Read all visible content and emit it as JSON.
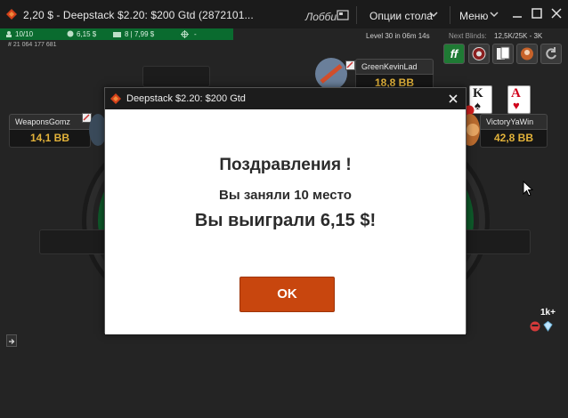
{
  "window": {
    "title": "2,20 $ - Deepstack $2.20: $200 Gtd  (2872101...",
    "lobby_label": "Лобби",
    "table_options_label": "Опции стола",
    "menu_label": "Меню"
  },
  "info": {
    "players": "10/10",
    "prize": "6,15 $",
    "tables": "8 | 7,99 $",
    "table_id": "# 21 064 177 681",
    "level": "Level 30   in 06m 14s",
    "next_blinds_label": "Next Blinds:",
    "next_blinds_value": "12,5K/25K  - 3K"
  },
  "toolbar": {
    "ff_label": "ff"
  },
  "seats": [
    {
      "name": "GreenKevinLad",
      "stack": "18,8 BB"
    },
    {
      "name": "WeaponsGomz",
      "stack": "14,1 BB"
    },
    {
      "name": "VictoryYaWin",
      "stack": "42,8 BB"
    }
  ],
  "hero_cards": [
    {
      "rank": "K",
      "suit": "♠",
      "color": "#1a1a1a"
    },
    {
      "rank": "A",
      "suit": "♥",
      "color": "#d0021b"
    }
  ],
  "misc": {
    "count_label": "1k+"
  },
  "modal": {
    "title": "Deepstack $2.20: $200 Gtd",
    "heading": "Поздравления !",
    "place_text": "Вы заняли 10 место",
    "won_text": "Вы выиграли 6,15 $!",
    "ok_label": "OK"
  },
  "colors": {
    "accent": "#c8460e",
    "felt": "#0e5a2a",
    "stack_text": "#e2b23a"
  }
}
